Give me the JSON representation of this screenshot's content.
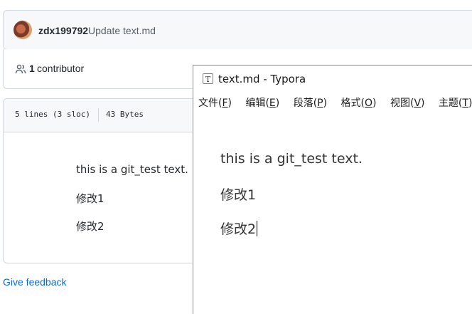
{
  "commit": {
    "author": "zdx199792",
    "message": "Update text.md"
  },
  "contributors": {
    "count": "1",
    "label": "contributor"
  },
  "file": {
    "lines": "5 lines (3 sloc)",
    "size": "43 Bytes",
    "content": [
      "this is a git_test text.",
      "修改1",
      "修改2"
    ]
  },
  "feedback": "Give feedback",
  "typora": {
    "icon_letter": "T",
    "title": "text.md - Typora",
    "menu": [
      {
        "label": "文件(",
        "key": "F",
        "tail": ")"
      },
      {
        "label": "编辑(",
        "key": "E",
        "tail": ")"
      },
      {
        "label": "段落(",
        "key": "P",
        "tail": ")"
      },
      {
        "label": "格式(",
        "key": "O",
        "tail": ")"
      },
      {
        "label": "视图(",
        "key": "V",
        "tail": ")"
      },
      {
        "label": "主题(",
        "key": "T",
        "tail": ")"
      }
    ],
    "content": [
      "this is a git_test text.",
      "修改1",
      "修改2"
    ]
  }
}
